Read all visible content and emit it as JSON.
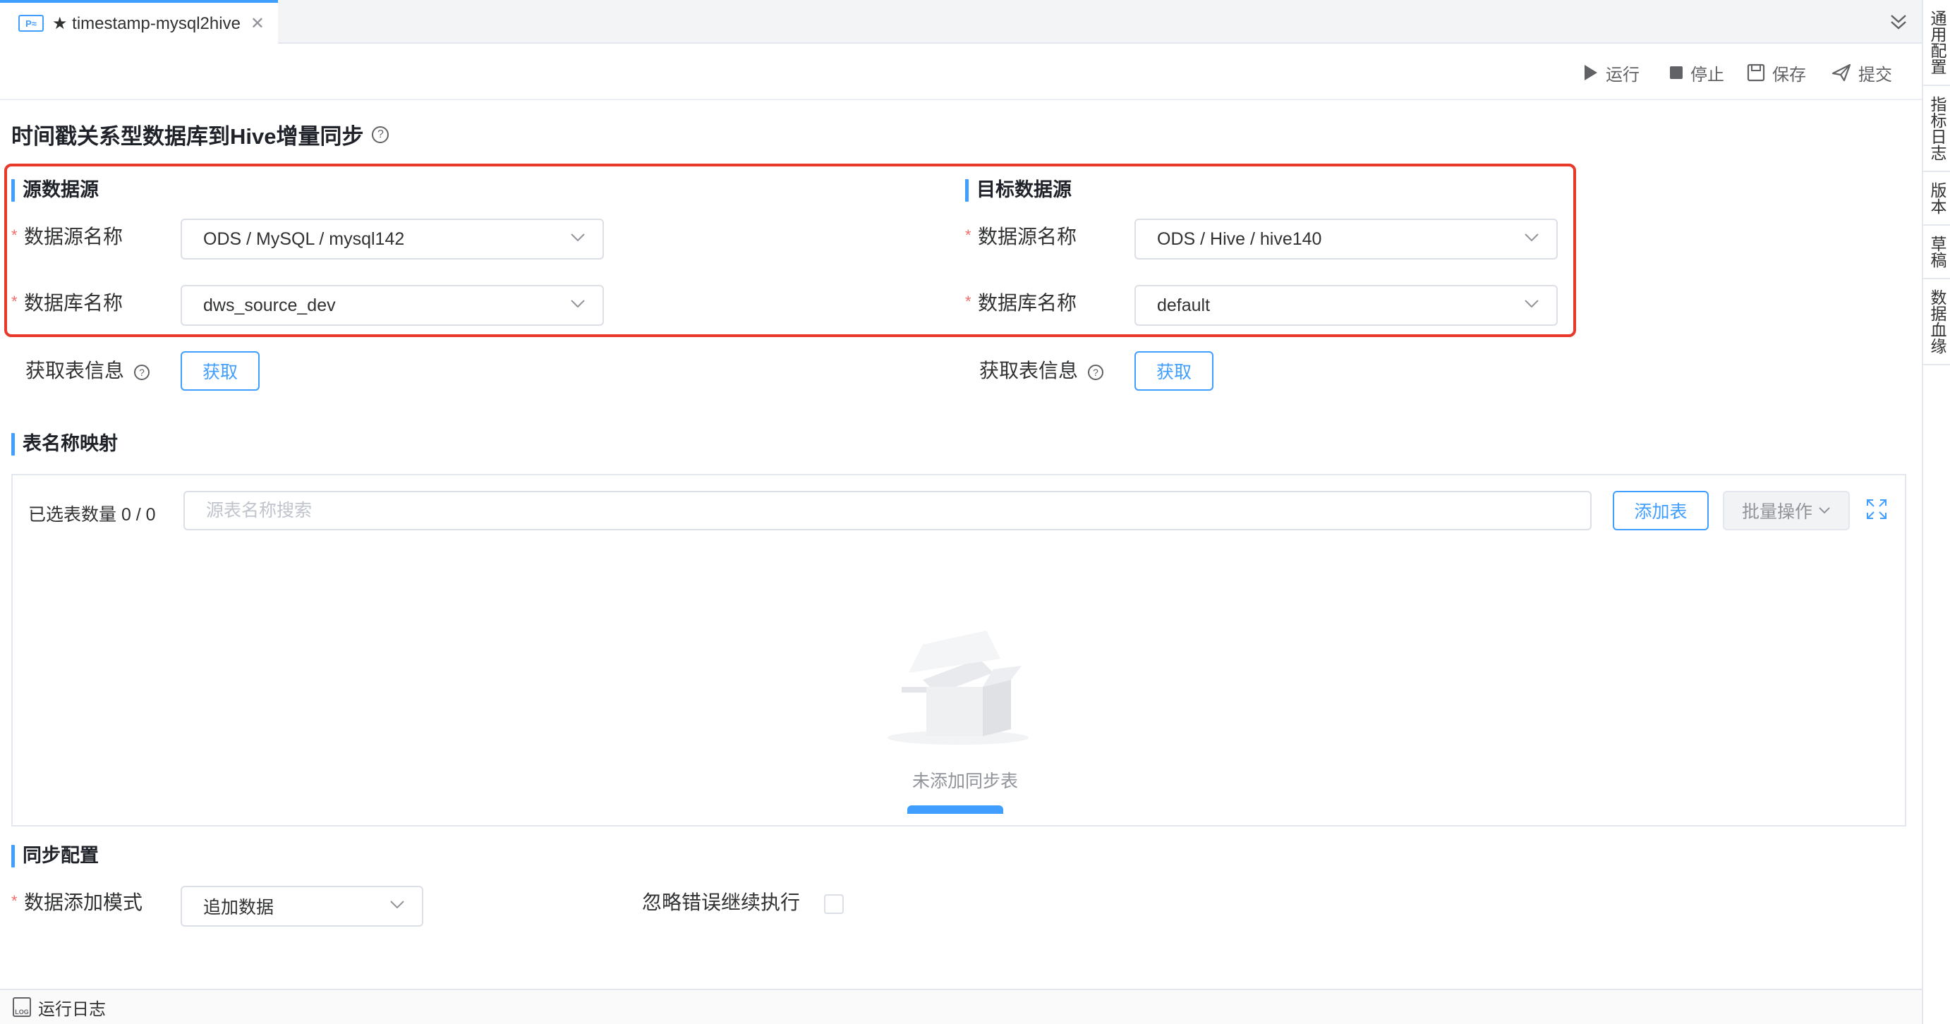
{
  "tab": {
    "icon_text": "P≈",
    "title": "★ timestamp-mysql2hive",
    "close_icon": "close-icon"
  },
  "right_sidebar": {
    "items": [
      {
        "label": "通用配置"
      },
      {
        "label": "指标日志"
      },
      {
        "label": "版本"
      },
      {
        "label": "草稿"
      },
      {
        "label": "数据血缘"
      }
    ]
  },
  "toolbar": {
    "run_label": "运行",
    "stop_label": "停止",
    "save_label": "保存",
    "submit_label": "提交"
  },
  "page": {
    "title": "时间戳关系型数据库到Hive增量同步",
    "help_symbol": "?"
  },
  "source": {
    "heading": "源数据源",
    "datasource_label": "数据源名称",
    "datasource_value": "ODS / MySQL / mysql142",
    "database_label": "数据库名称",
    "database_value": "dws_source_dev",
    "fetch_label": "获取表信息",
    "fetch_button": "获取"
  },
  "target": {
    "heading": "目标数据源",
    "datasource_label": "数据源名称",
    "datasource_value": "ODS / Hive / hive140",
    "database_label": "数据库名称",
    "database_value": "default",
    "fetch_label": "获取表信息",
    "fetch_button": "获取"
  },
  "required_mark": "*",
  "mapping": {
    "heading": "表名称映射",
    "selected_count": "已选表数量 0 / 0",
    "search_placeholder": "源表名称搜索",
    "add_table_button": "添加表",
    "batch_button": "批量操作",
    "empty_text": "未添加同步表"
  },
  "sync": {
    "heading": "同步配置",
    "mode_label": "数据添加模式",
    "mode_value": "追加数据",
    "ignore_errors_label": "忽略错误继续执行",
    "ignore_errors_checked": false
  },
  "bottom": {
    "log_label": "运行日志",
    "log_icon_text": "LOG"
  },
  "colors": {
    "accent": "#409eff",
    "highlight": "#e8382a",
    "required": "#f56c6c"
  }
}
